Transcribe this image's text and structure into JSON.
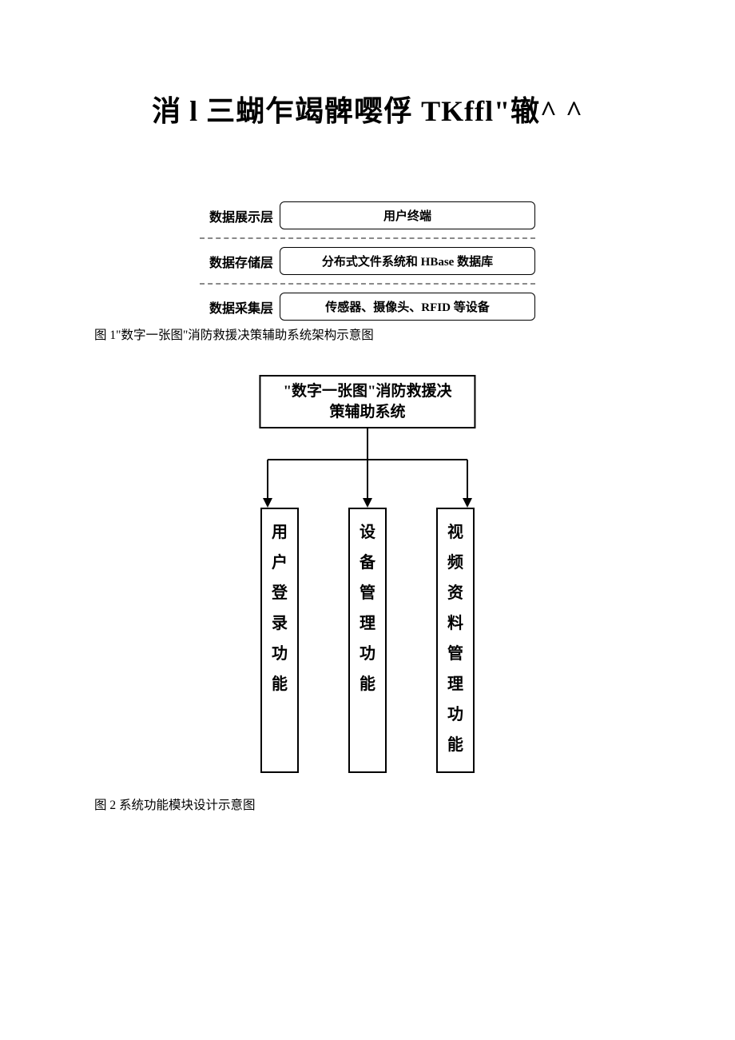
{
  "title": "消 l 三蝴乍竭髀嘤俘 TKffl\"辙^ ^",
  "figure1": {
    "rows": [
      {
        "label": "数据展示层",
        "box": "用户终端"
      },
      {
        "label": "数据存储层",
        "box": "分布式文件系统和 HBase 数据库"
      },
      {
        "label": "数据采集层",
        "box": "传感器、摄像头、RFID 等设备"
      }
    ],
    "caption": "图 1\"数字一张图\"消防救援决策辅助系统架构示意图"
  },
  "figure2": {
    "top": "\"数字一张图\"消防救援决\n策辅助系统",
    "children": [
      "用户登录功能",
      "设备管理功能",
      "视频资料管理功能"
    ],
    "caption": "图 2 系统功能模块设计示意图"
  },
  "chart_data": [
    {
      "type": "diagram-layered-architecture",
      "title": "\"数字一张图\"消防救援决策辅助系统架构示意图",
      "layers": [
        {
          "name": "数据展示层",
          "component": "用户终端"
        },
        {
          "name": "数据存储层",
          "component": "分布式文件系统和 HBase 数据库"
        },
        {
          "name": "数据采集层",
          "component": "传感器、摄像头、RFID 等设备"
        }
      ]
    },
    {
      "type": "tree",
      "title": "系统功能模块设计示意图",
      "root": "\"数字一张图\"消防救援决策辅助系统",
      "children": [
        "用户登录功能",
        "设备管理功能",
        "视频资料管理功能"
      ]
    }
  ]
}
